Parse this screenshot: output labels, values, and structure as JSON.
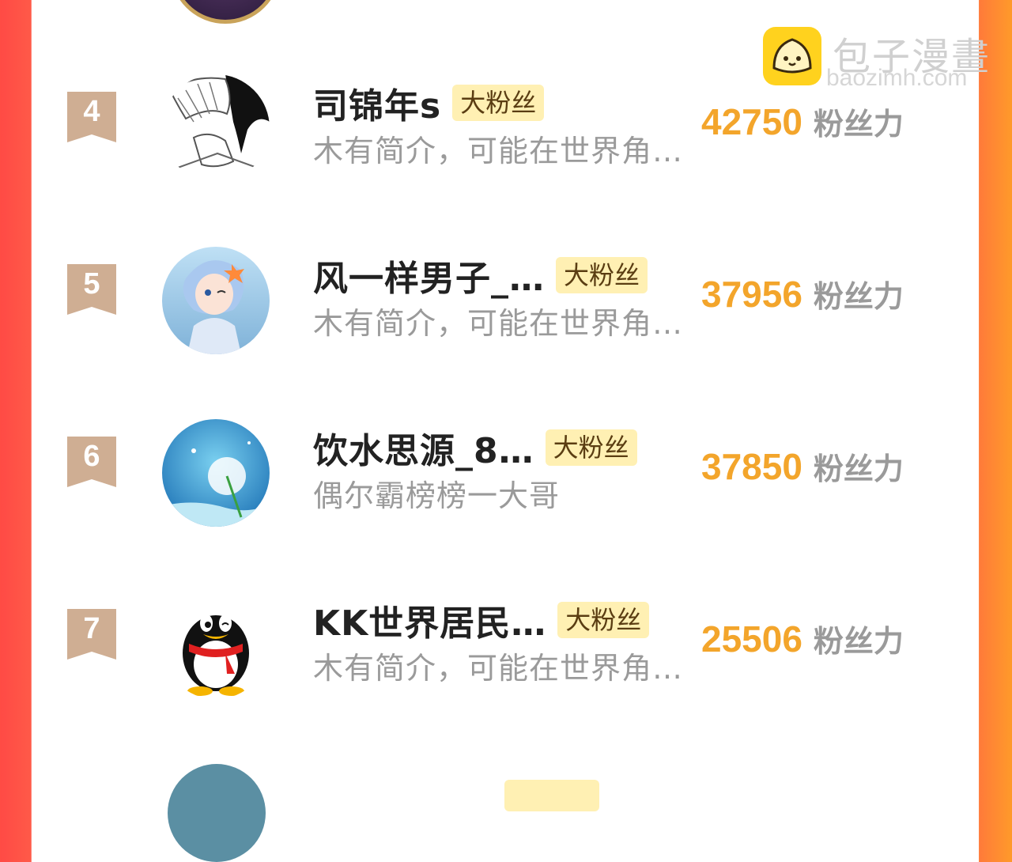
{
  "watermark": {
    "title": "包子漫畫",
    "domain": "baozimh.com"
  },
  "colors": {
    "accent": "#f3a52b",
    "badge_bg": "#fff0b3",
    "rank_ribbon": "#cfae93",
    "side_left": "#ff4a45",
    "side_right": "#ff9a2a"
  },
  "rows": [
    {
      "rank": "4",
      "name": "司锦年s",
      "badge": "大粉丝",
      "desc": "木有简介，可能在世界角…",
      "score": "42750",
      "unit": "粉丝力"
    },
    {
      "rank": "5",
      "name": "风一样男子_…",
      "badge": "大粉丝",
      "desc": "木有简介，可能在世界角…",
      "score": "37956",
      "unit": "粉丝力"
    },
    {
      "rank": "6",
      "name": "饮水思源_8…",
      "badge": "大粉丝",
      "desc": "偶尔霸榜榜一大哥",
      "score": "37850",
      "unit": "粉丝力"
    },
    {
      "rank": "7",
      "name": "KK世界居民…",
      "badge": "大粉丝",
      "desc": "木有简介，可能在世界角…",
      "score": "25506",
      "unit": "粉丝力"
    }
  ]
}
